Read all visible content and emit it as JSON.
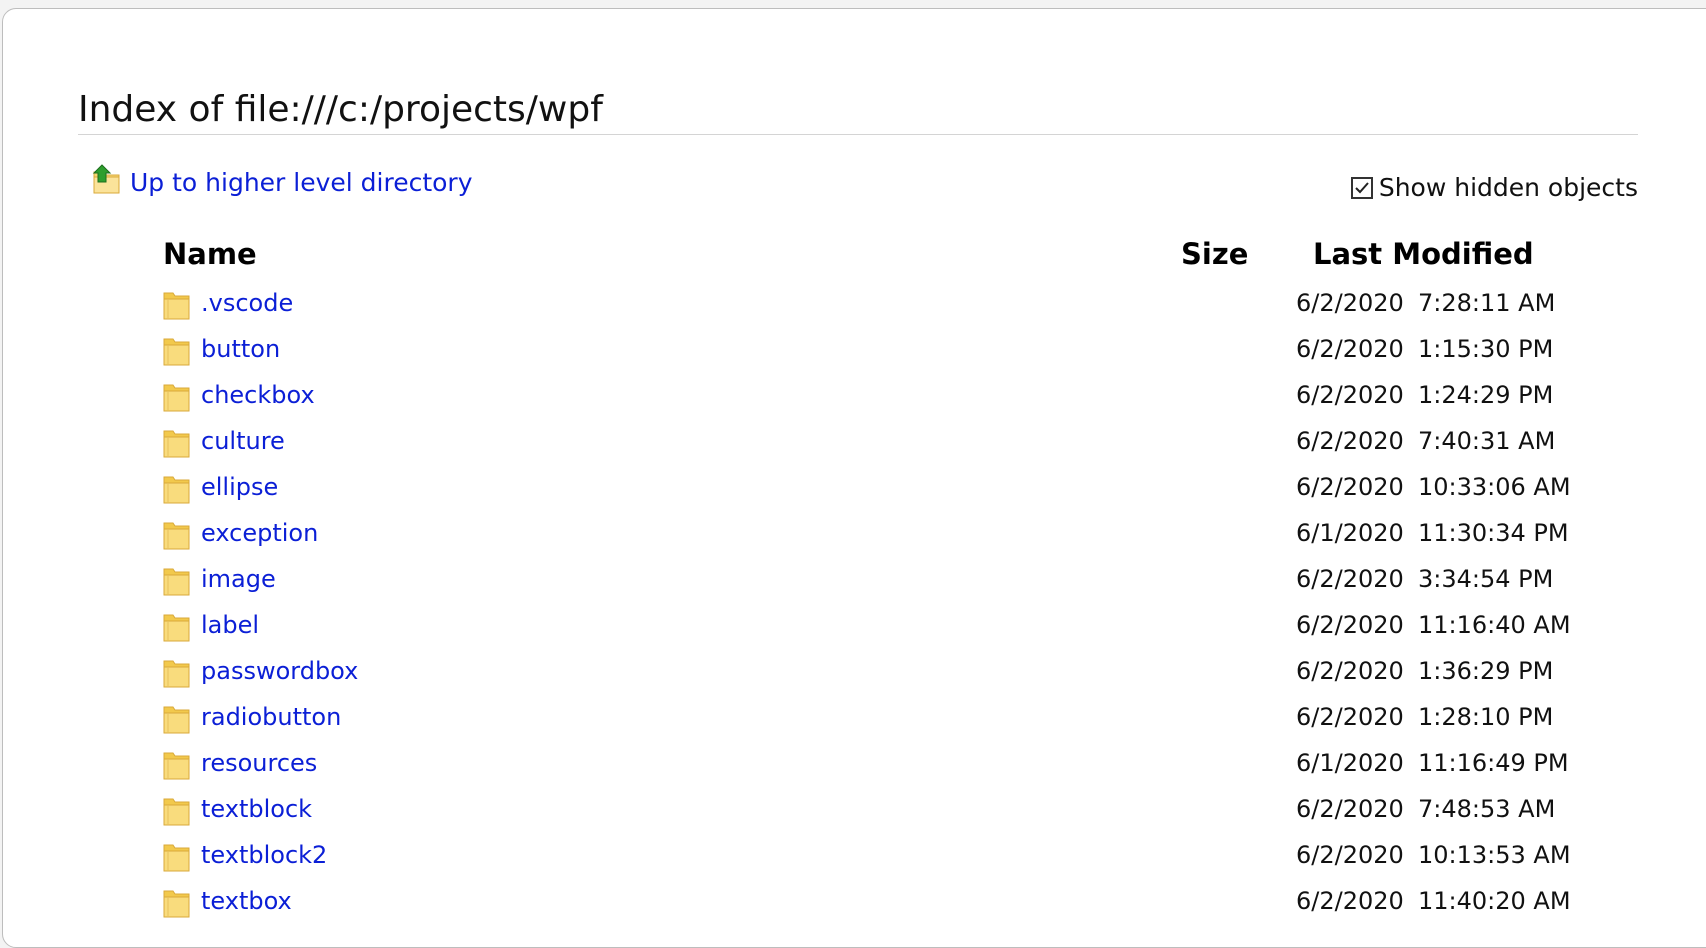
{
  "page": {
    "title": "Index of file:///c:/projects/wpf",
    "up_link_label": "Up to higher level directory",
    "show_hidden_label": "Show hidden objects",
    "show_hidden_checked": true
  },
  "table": {
    "headers": {
      "name": "Name",
      "size": "Size",
      "last_modified": "Last Modified"
    },
    "rows": [
      {
        "name": ".vscode",
        "size": "",
        "date": "6/2/2020",
        "time": "7:28:11 AM"
      },
      {
        "name": "button",
        "size": "",
        "date": "6/2/2020",
        "time": "1:15:30 PM"
      },
      {
        "name": "checkbox",
        "size": "",
        "date": "6/2/2020",
        "time": "1:24:29 PM"
      },
      {
        "name": "culture",
        "size": "",
        "date": "6/2/2020",
        "time": "7:40:31 AM"
      },
      {
        "name": "ellipse",
        "size": "",
        "date": "6/2/2020",
        "time": "10:33:06 AM"
      },
      {
        "name": "exception",
        "size": "",
        "date": "6/1/2020",
        "time": "11:30:34 PM"
      },
      {
        "name": "image",
        "size": "",
        "date": "6/2/2020",
        "time": "3:34:54 PM"
      },
      {
        "name": "label",
        "size": "",
        "date": "6/2/2020",
        "time": "11:16:40 AM"
      },
      {
        "name": "passwordbox",
        "size": "",
        "date": "6/2/2020",
        "time": "1:36:29 PM"
      },
      {
        "name": "radiobutton",
        "size": "",
        "date": "6/2/2020",
        "time": "1:28:10 PM"
      },
      {
        "name": "resources",
        "size": "",
        "date": "6/1/2020",
        "time": "11:16:49 PM"
      },
      {
        "name": "textblock",
        "size": "",
        "date": "6/2/2020",
        "time": "7:48:53 AM"
      },
      {
        "name": "textblock2",
        "size": "",
        "date": "6/2/2020",
        "time": "10:13:53 AM"
      },
      {
        "name": "textbox",
        "size": "",
        "date": "6/2/2020",
        "time": "11:40:20 AM"
      }
    ]
  },
  "icons": {
    "folder": "folder-icon",
    "up_directory": "up-directory-icon",
    "checkmark": "checkmark-icon"
  },
  "colors": {
    "link": "#0b1fd6",
    "folder_fill": "#f7d774",
    "folder_edge": "#d9a93a",
    "up_arrow": "#2e9e2e"
  }
}
